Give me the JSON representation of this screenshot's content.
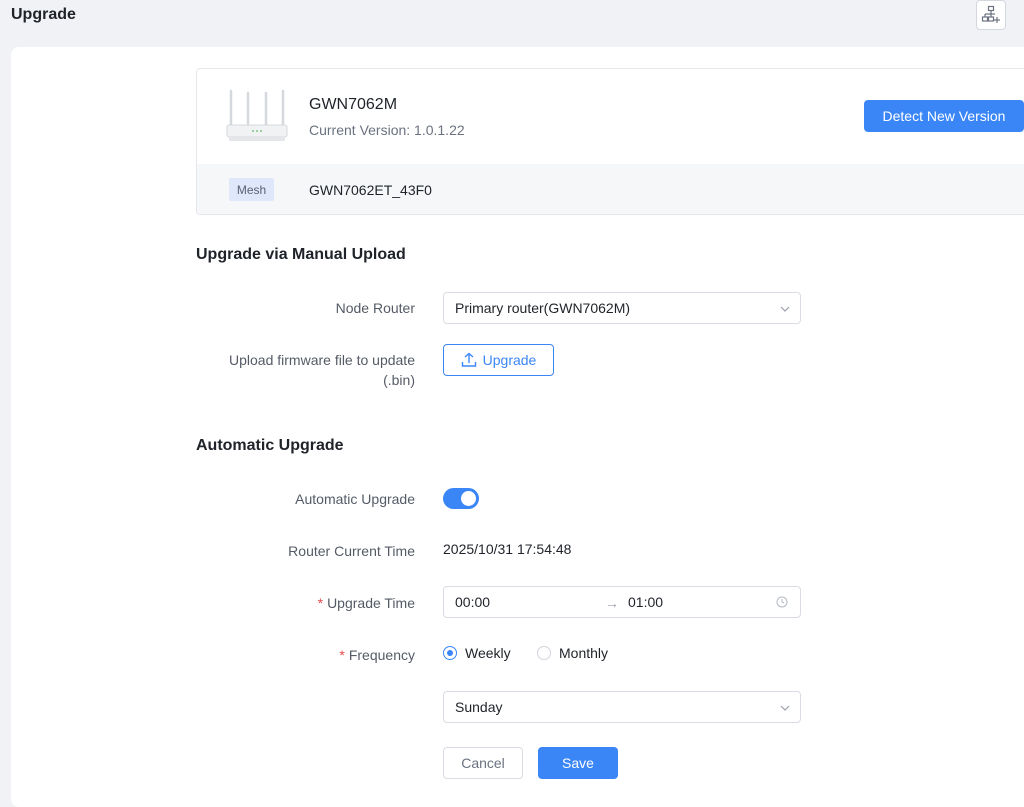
{
  "header": {
    "title": "Upgrade",
    "topology_icon": "network-topology-add-icon"
  },
  "device": {
    "model": "GWN7062M",
    "current_version": "Current Version: 1.0.1.22",
    "detect_button": "Detect New Version",
    "mesh_tag": "Mesh",
    "mesh_node": "GWN7062ET_43F0"
  },
  "manual": {
    "title": "Upgrade via Manual Upload",
    "node_router_label": "Node Router",
    "node_router_value": "Primary router(GWN7062M)",
    "upload_label_line1": "Upload firmware file to update",
    "upload_label_line2": "(.bin)",
    "upload_button": "Upgrade"
  },
  "auto": {
    "title": "Automatic Upgrade",
    "toggle_label": "Automatic Upgrade",
    "toggle_on": true,
    "current_time_label": "Router Current Time",
    "current_time_value": "2025/10/31 17:54:48",
    "upgrade_time_label": "Upgrade Time",
    "upgrade_time_start": "00:00",
    "upgrade_time_arrow": "→",
    "upgrade_time_end": "01:00",
    "frequency_label": "Frequency",
    "frequency_options": [
      "Weekly",
      "Monthly"
    ],
    "frequency_selected": "Weekly",
    "day_value": "Sunday",
    "required_mark": "*"
  },
  "actions": {
    "cancel": "Cancel",
    "save": "Save"
  },
  "colors": {
    "accent": "#3b86f7",
    "required": "#e5484d"
  }
}
